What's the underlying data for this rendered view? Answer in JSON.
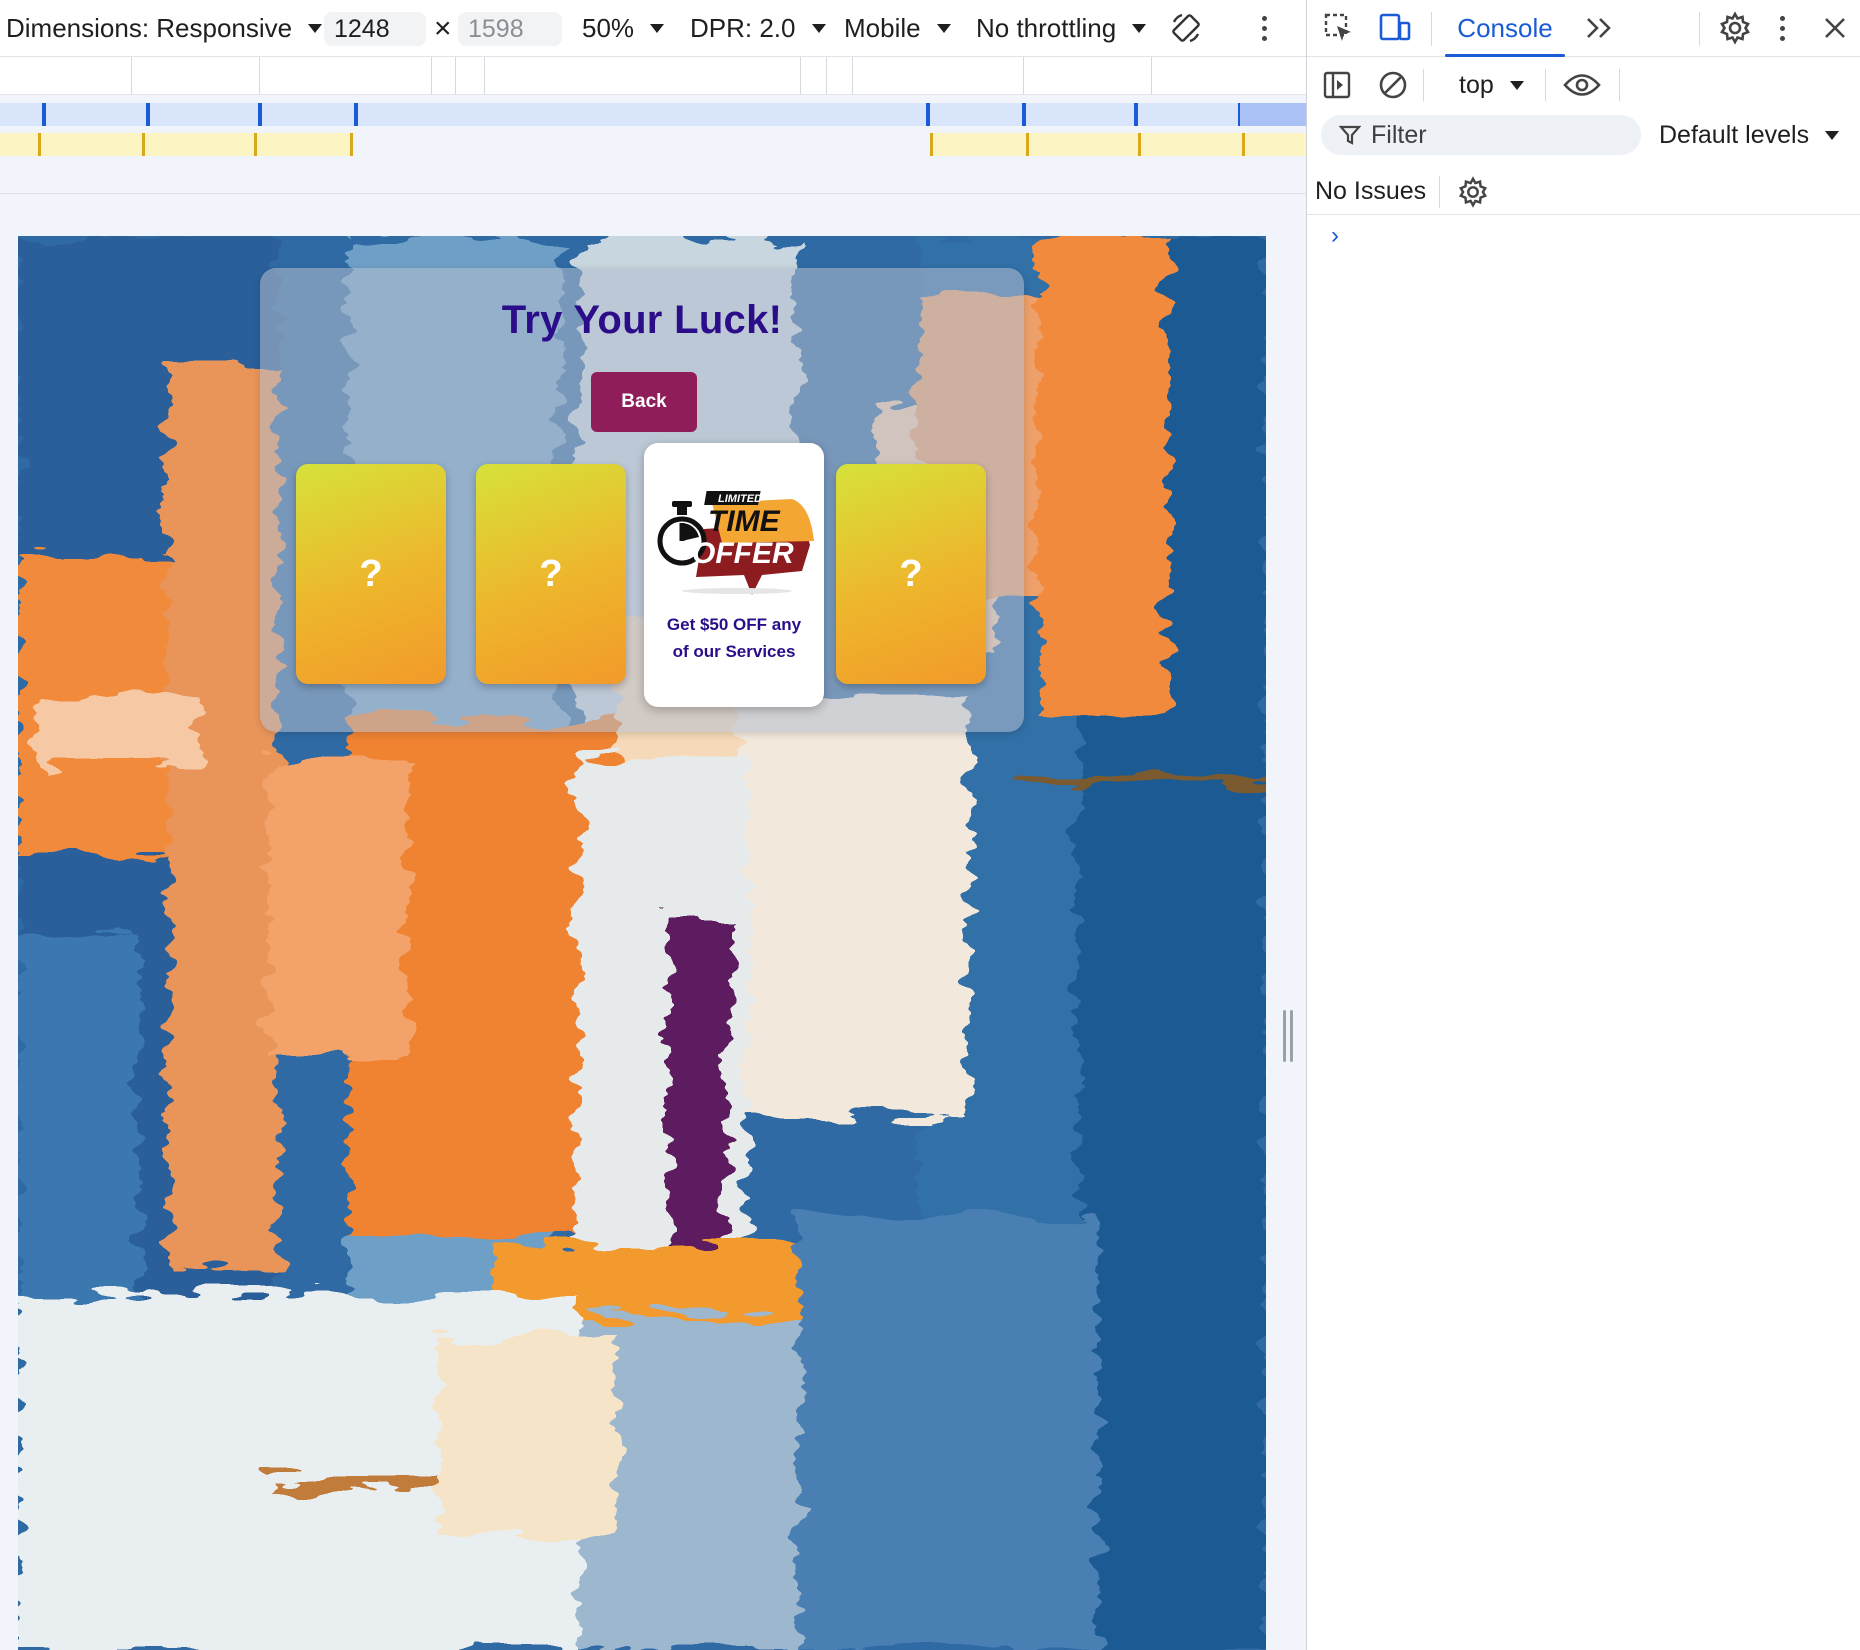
{
  "device_toolbar": {
    "dimensions_label": "Dimensions: Responsive",
    "width_value": "1248",
    "height_placeholder": "1598",
    "times_symbol": "×",
    "zoom": "50%",
    "dpr": "DPR: 2.0",
    "device_type": "Mobile",
    "throttling": "No throttling"
  },
  "devtools": {
    "tabs": {
      "console": "Console"
    },
    "context": "top",
    "filter_placeholder": "Filter",
    "levels": "Default levels",
    "issues": "No Issues",
    "prompt_symbol": "›"
  },
  "page": {
    "title": "Try Your Luck!",
    "back_button": "Back",
    "cards": [
      {
        "state": "hidden",
        "symbol": "?"
      },
      {
        "state": "hidden",
        "symbol": "?"
      },
      {
        "state": "revealed",
        "prize": "Get $50 OFF any of our Services",
        "logo_top": "LIMITED",
        "logo_mid": "TIME",
        "logo_bottom": "OFFER"
      },
      {
        "state": "hidden",
        "symbol": "?"
      }
    ]
  },
  "colors": {
    "title": "#2b0d8a",
    "back_button_bg": "#8f1d5a",
    "card_gradient_start": "#d6e23a",
    "card_gradient_end": "#f29a2a",
    "devtools_accent": "#1a5bd6"
  }
}
